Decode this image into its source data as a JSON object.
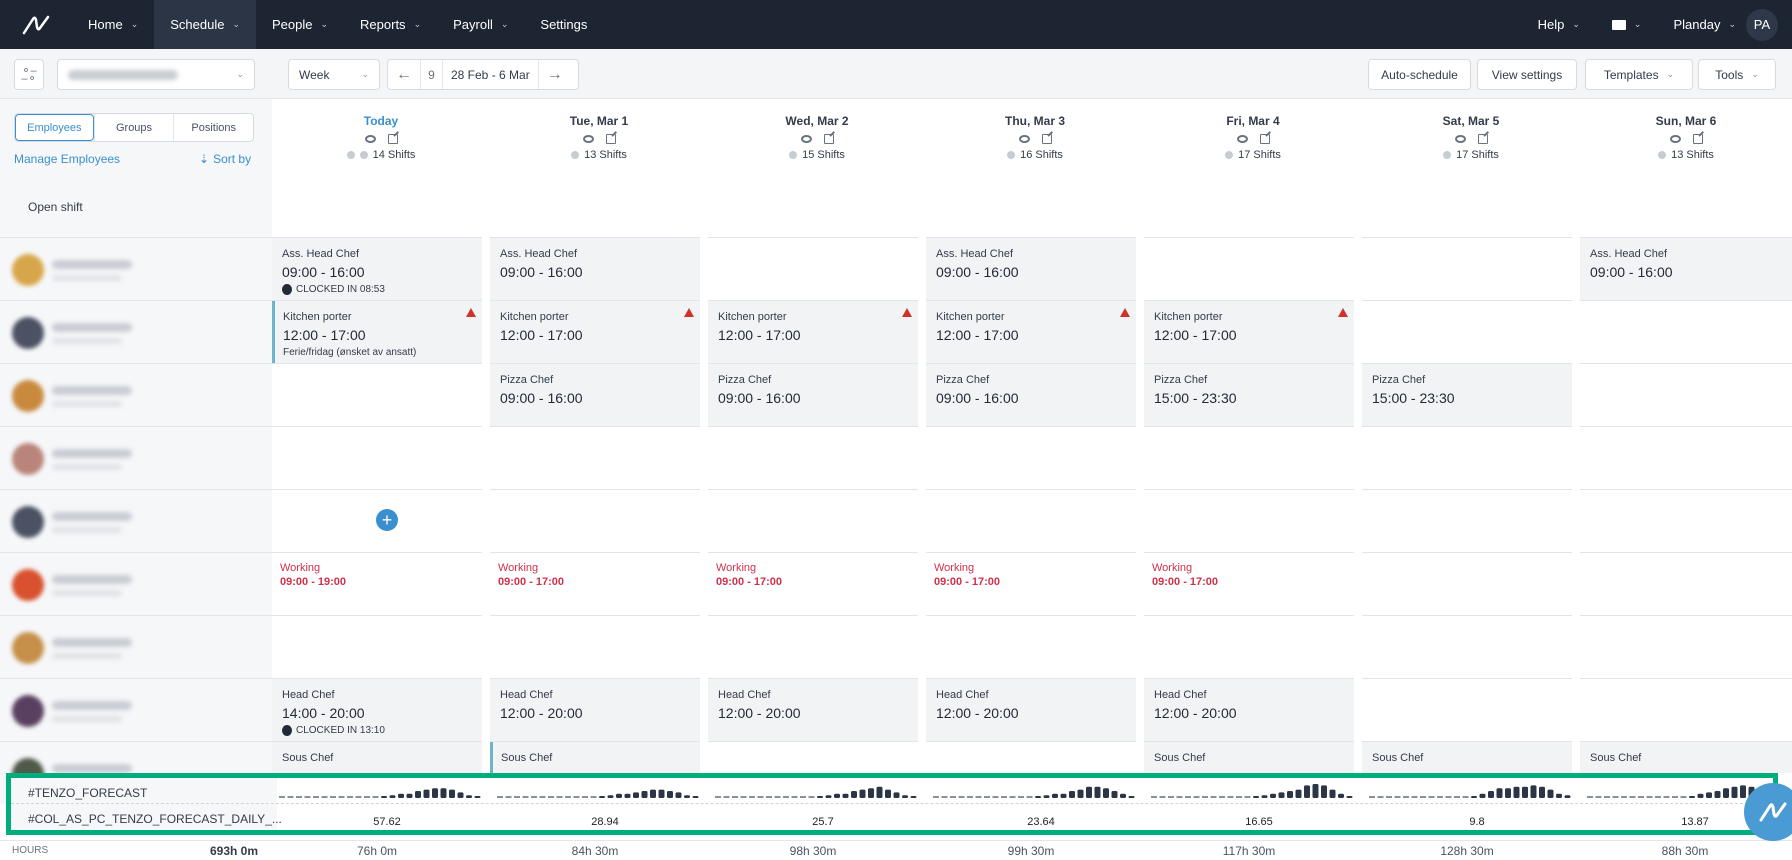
{
  "nav": {
    "items": [
      {
        "label": "Home",
        "dropdown": true
      },
      {
        "label": "Schedule",
        "dropdown": true,
        "active": true
      },
      {
        "label": "People",
        "dropdown": true
      },
      {
        "label": "Reports",
        "dropdown": true
      },
      {
        "label": "Payroll",
        "dropdown": true
      },
      {
        "label": "Settings",
        "dropdown": false
      }
    ],
    "help": "Help",
    "company": "Planday",
    "avatar_initials": "PA",
    "mail_icon": "envelope-icon"
  },
  "toolbar": {
    "department_value": "(blurred)",
    "view_select": "Week",
    "week_number": "9",
    "date_range": "28 Feb - 6 Mar",
    "auto_schedule": "Auto-schedule",
    "view_settings": "View settings",
    "templates": "Templates",
    "tools": "Tools"
  },
  "left": {
    "tabs": [
      "Employees",
      "Groups",
      "Positions"
    ],
    "active_tab": "Employees",
    "manage_employees": "Manage Employees",
    "sort_by": "Sort by",
    "open_shift": "Open shift"
  },
  "days": [
    {
      "label": "Today",
      "today": true,
      "shifts": "14 Shifts"
    },
    {
      "label": "Tue, Mar 1",
      "shifts": "13 Shifts"
    },
    {
      "label": "Wed, Mar 2",
      "shifts": "15 Shifts"
    },
    {
      "label": "Thu, Mar 3",
      "shifts": "16 Shifts"
    },
    {
      "label": "Fri, Mar 4",
      "shifts": "17 Shifts"
    },
    {
      "label": "Sat, Mar 5",
      "shifts": "17 Shifts"
    },
    {
      "label": "Sun, Mar 6",
      "shifts": "13 Shifts"
    }
  ],
  "employees": [
    {
      "avatar_color": "#d8a64a"
    },
    {
      "avatar_color": "#4a5263"
    },
    {
      "avatar_color": "#c98a3e"
    },
    {
      "avatar_color": "#b9857a"
    },
    {
      "avatar_color": "#4a5263"
    },
    {
      "avatar_color": "#d9512e"
    },
    {
      "avatar_color": "#c7904a"
    },
    {
      "avatar_color": "#5a4060"
    },
    {
      "avatar_color": "#4f5a48"
    }
  ],
  "shifts": [
    {
      "row": 0,
      "day": 0,
      "position": "Ass. Head Chef",
      "time": "09:00  - 16:00",
      "note": "CLOCKED IN 08:53",
      "clock": true
    },
    {
      "row": 0,
      "day": 1,
      "position": "Ass. Head Chef",
      "time": "09:00  - 16:00"
    },
    {
      "row": 0,
      "day": 3,
      "position": "Ass. Head Chef",
      "time": "09:00  - 16:00"
    },
    {
      "row": 0,
      "day": 6,
      "position": "Ass. Head Chef",
      "time": "09:00  - 16:00"
    },
    {
      "row": 1,
      "day": 0,
      "position": "Kitchen porter",
      "time": "12:00  - 17:00",
      "note": "Ferie/fridag (ønsket av ansatt)",
      "warning": true,
      "bar": true
    },
    {
      "row": 1,
      "day": 1,
      "position": "Kitchen porter",
      "time": "12:00  - 17:00",
      "warning": true
    },
    {
      "row": 1,
      "day": 2,
      "position": "Kitchen porter",
      "time": "12:00  - 17:00",
      "warning": true
    },
    {
      "row": 1,
      "day": 3,
      "position": "Kitchen porter",
      "time": "12:00  - 17:00",
      "warning": true
    },
    {
      "row": 1,
      "day": 4,
      "position": "Kitchen porter",
      "time": "12:00  - 17:00",
      "warning": true
    },
    {
      "row": 2,
      "day": 1,
      "position": "Pizza Chef",
      "time": "09:00  - 16:00"
    },
    {
      "row": 2,
      "day": 2,
      "position": "Pizza Chef",
      "time": "09:00  - 16:00"
    },
    {
      "row": 2,
      "day": 3,
      "position": "Pizza Chef",
      "time": "09:00  - 16:00"
    },
    {
      "row": 2,
      "day": 4,
      "position": "Pizza Chef",
      "time": "15:00  - 23:30"
    },
    {
      "row": 2,
      "day": 5,
      "position": "Pizza Chef",
      "time": "15:00  - 23:30"
    },
    {
      "row": 7,
      "day": 0,
      "position": "Head Chef",
      "time": "14:00  - 20:00",
      "note": "CLOCKED IN 13:10",
      "clock": true
    },
    {
      "row": 7,
      "day": 1,
      "position": "Head Chef",
      "time": "12:00  - 20:00"
    },
    {
      "row": 7,
      "day": 2,
      "position": "Head Chef",
      "time": "12:00  - 20:00"
    },
    {
      "row": 7,
      "day": 3,
      "position": "Head Chef",
      "time": "12:00  - 20:00"
    },
    {
      "row": 7,
      "day": 4,
      "position": "Head Chef",
      "time": "12:00  - 20:00"
    },
    {
      "row": 8,
      "day": 0,
      "position": "Sous Chef",
      "time": ""
    },
    {
      "row": 8,
      "day": 1,
      "position": "Sous Chef",
      "time": "",
      "bar": true
    },
    {
      "row": 8,
      "day": 4,
      "position": "Sous Chef",
      "time": ""
    },
    {
      "row": 8,
      "day": 5,
      "position": "Sous Chef",
      "time": ""
    },
    {
      "row": 8,
      "day": 6,
      "position": "Sous Chef",
      "time": ""
    }
  ],
  "availability": [
    {
      "row": 5,
      "day": 0,
      "label": "Working",
      "time": "09:00 - 19:00"
    },
    {
      "row": 5,
      "day": 1,
      "label": "Working",
      "time": "09:00 - 17:00"
    },
    {
      "row": 5,
      "day": 2,
      "label": "Working",
      "time": "09:00 - 17:00"
    },
    {
      "row": 5,
      "day": 3,
      "label": "Working",
      "time": "09:00 - 17:00"
    },
    {
      "row": 5,
      "day": 4,
      "label": "Working",
      "time": "09:00 - 17:00"
    }
  ],
  "forecast": {
    "label": "#TENZO_FORECAST",
    "daily_label": "#COL_AS_PC_TENZO_FORECAST_DAILY_...",
    "daily_values": [
      "57.62",
      "28.94",
      "25.7",
      "23.64",
      "16.65",
      "9.8",
      "13.87"
    ],
    "hourly": [
      [
        0,
        0,
        0,
        0,
        0,
        0,
        0,
        0,
        0,
        0,
        0,
        0,
        0.1,
        0.2,
        0.3,
        0.3,
        0.5,
        0.6,
        0.7,
        0.7,
        0.6,
        0.4,
        0.2,
        0.1
      ],
      [
        0,
        0,
        0,
        0,
        0,
        0,
        0,
        0,
        0,
        0,
        0,
        0,
        0.1,
        0.2,
        0.3,
        0.3,
        0.4,
        0.5,
        0.6,
        0.6,
        0.5,
        0.4,
        0.2,
        0.1
      ],
      [
        0,
        0,
        0,
        0,
        0,
        0,
        0,
        0,
        0,
        0,
        0,
        0,
        0.1,
        0.2,
        0.3,
        0.3,
        0.5,
        0.6,
        0.7,
        0.8,
        0.6,
        0.4,
        0.2,
        0.1
      ],
      [
        0,
        0,
        0,
        0,
        0,
        0,
        0,
        0,
        0,
        0,
        0,
        0,
        0.1,
        0.2,
        0.3,
        0.3,
        0.5,
        0.6,
        0.8,
        0.8,
        0.7,
        0.5,
        0.3,
        0.1
      ],
      [
        0,
        0,
        0,
        0,
        0,
        0,
        0,
        0,
        0,
        0,
        0,
        0,
        0.1,
        0.2,
        0.3,
        0.4,
        0.5,
        0.6,
        0.9,
        1.0,
        0.9,
        0.6,
        0.3,
        0.1
      ],
      [
        0,
        0,
        0,
        0,
        0,
        0,
        0,
        0,
        0,
        0,
        0,
        0,
        0.1,
        0.3,
        0.5,
        0.7,
        0.7,
        0.8,
        0.8,
        0.9,
        0.8,
        0.6,
        0.3,
        0.2
      ],
      [
        0,
        0,
        0,
        0,
        0,
        0,
        0,
        0,
        0,
        0,
        0,
        0,
        0.1,
        0.3,
        0.4,
        0.5,
        0.7,
        0.8,
        0.9,
        0.8,
        0.6,
        0.4,
        0.3,
        0.2
      ]
    ]
  },
  "hours": {
    "label": "HOURS",
    "total": "693h 0m",
    "per_day": [
      "76h 0m",
      "84h 30m",
      "98h 30m",
      "99h 30m",
      "117h 30m",
      "128h 30m",
      "88h 30m"
    ]
  }
}
